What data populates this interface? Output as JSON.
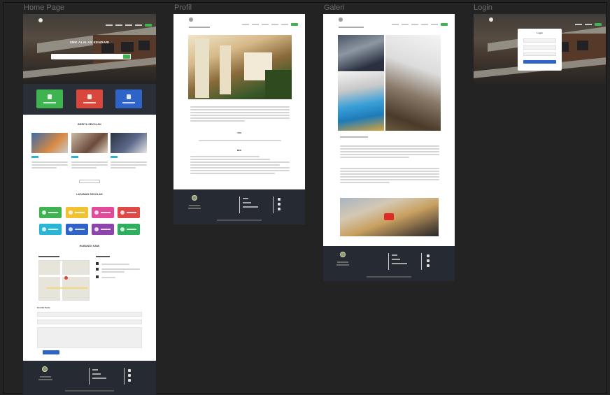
{
  "frames": {
    "home": {
      "title": "Home Page"
    },
    "profile": {
      "title": "Profil"
    },
    "gallery": {
      "title": "Galeri"
    },
    "login": {
      "title": "Login"
    }
  },
  "home": {
    "hero_title": "SMK ALALAS KENDARI",
    "section_news": "BERITA SEKOLAH",
    "section_services": "LAYANAN SEKOLAH",
    "section_contact": "HUBUNGI KAMI",
    "contact_form_label": "Kontak Kami",
    "features": [
      {
        "color": "#3fb34f",
        "icon": "book-icon"
      },
      {
        "color": "#d9463b",
        "icon": "graduation-icon"
      },
      {
        "color": "#2e63c7",
        "icon": "users-icon"
      }
    ],
    "services": [
      {
        "color": "#3fb34f"
      },
      {
        "color": "#f1c231"
      },
      {
        "color": "#e24a9a"
      },
      {
        "color": "#e04848"
      },
      {
        "color": "#29b6d6"
      },
      {
        "color": "#2e63c7"
      },
      {
        "color": "#8e44ad"
      },
      {
        "color": "#2eae5f"
      }
    ]
  },
  "profile": {
    "heading_1": "VISI",
    "heading_2": "MISI"
  },
  "login": {
    "title": "Login"
  },
  "colors": {
    "accent_green": "#3fb34f",
    "footer_dark": "#262a33",
    "canvas": "#232323"
  }
}
